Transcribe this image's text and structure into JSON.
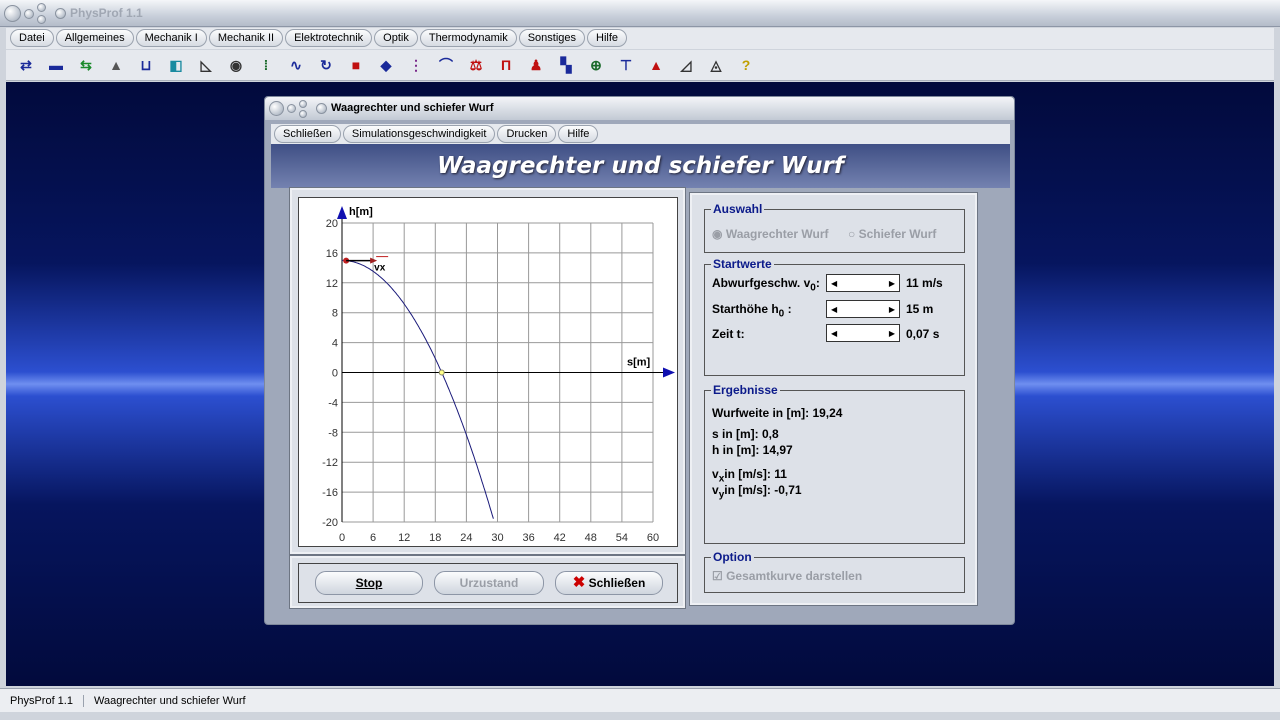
{
  "app": {
    "title": "PhysProf 1.1"
  },
  "menu": [
    "Datei",
    "Allgemeines",
    "Mechanik I",
    "Mechanik II",
    "Elektrotechnik",
    "Optik",
    "Thermodynamik",
    "Sonstiges",
    "Hilfe"
  ],
  "toolbar_icons": [
    "collision-icon",
    "momentum-icon",
    "acceleration-velocity-icon",
    "bell-curve-icon",
    "container-icon",
    "pump-icon",
    "incline-icon",
    "eye-icon",
    "dots-icon",
    "wave-icon",
    "rotation-icon",
    "weight-icon",
    "tilt-icon",
    "spring-icon",
    "graph-icon",
    "balance-icon",
    "pulley-icon",
    "molecule-icon",
    "blocks-icon",
    "engine-icon",
    "lever-icon",
    "prism-icon",
    "curve-icon",
    "distribution-icon",
    "help-icon"
  ],
  "status": {
    "app": "PhysProf 1.1",
    "window": "Waagrechter und schiefer Wurf"
  },
  "dialog": {
    "title": "Waagrechter und schiefer Wurf",
    "menu": [
      "Schließen",
      "Simulationsgeschwindigkeit",
      "Drucken",
      "Hilfe"
    ],
    "heading": "Waagrechter und schiefer Wurf",
    "buttons": {
      "stop": "Stop",
      "reset": "Urzustand",
      "close": "Schließen"
    },
    "auswahl": {
      "legend": "Auswahl",
      "opt1": "Waagrechter Wurf",
      "opt2": "Schiefer Wurf",
      "selected": "Waagrechter Wurf"
    },
    "startwerte": {
      "legend": "Startwerte",
      "v0_label": "Abwurfgeschw. v",
      "v0_sub": "0",
      "v0_value": "11 m/s",
      "h0_label": "Starthöhe h",
      "h0_sub": "0",
      "h0_value": "15 m",
      "t_label": "Zeit t:",
      "t_value": "0,07 s"
    },
    "ergebnisse": {
      "legend": "Ergebnisse",
      "wurfweite": "Wurfweite in [m]: 19,24",
      "s": "s in [m]:  0,8",
      "h": "h in [m]:  14,97",
      "vx_pre": "v",
      "vx_sub": "x",
      "vx_rest": "in [m/s]: 11",
      "vy_pre": "v",
      "vy_sub": "y",
      "vy_rest": "in [m/s]: -0,71"
    },
    "option": {
      "legend": "Option",
      "checkbox": "Gesamtkurve darstellen",
      "checked": true
    }
  },
  "chart_data": {
    "type": "line",
    "xlabel": "s[m]",
    "ylabel": "h[m]",
    "xlim": [
      0,
      60
    ],
    "ylim": [
      -20,
      20
    ],
    "xticks": [
      0,
      6,
      12,
      18,
      24,
      30,
      36,
      42,
      48,
      54,
      60
    ],
    "yticks": [
      20,
      16,
      12,
      8,
      4,
      0,
      -4,
      -8,
      -12,
      -16,
      -20
    ],
    "grid": true,
    "series": [
      {
        "v0": 11,
        "h0": 15,
        "g": 9.81,
        "color": "#1a1a7a"
      }
    ],
    "landing_point": [
      19.24,
      0
    ],
    "current_point": [
      0.8,
      14.97
    ],
    "vector_label": "vx",
    "axis_color": "#1010b0"
  }
}
